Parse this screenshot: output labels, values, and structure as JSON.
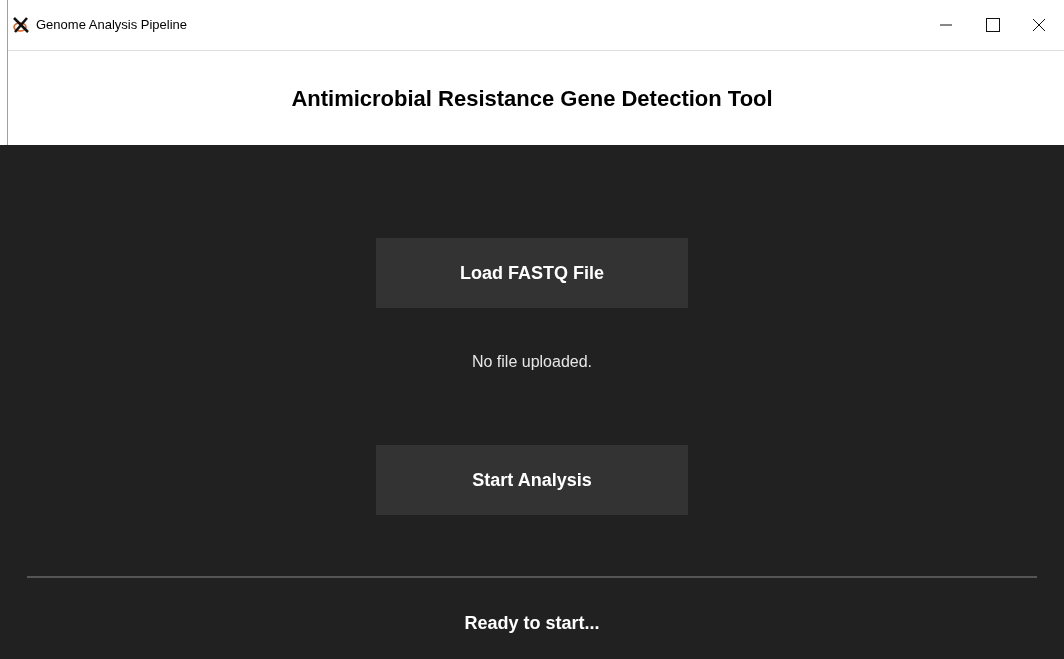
{
  "window": {
    "title": "Genome Analysis Pipeline"
  },
  "header": {
    "title": "Antimicrobial Resistance Gene Detection Tool"
  },
  "buttons": [
    {
      "label": "Load FASTQ File"
    },
    {
      "label": "Start Analysis"
    }
  ],
  "file_label": "No file uploaded.",
  "status_bar": "Ready to start..."
}
